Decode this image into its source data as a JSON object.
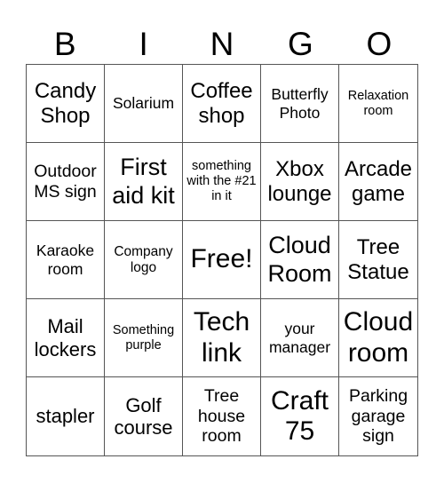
{
  "header": {
    "letters": [
      "B",
      "I",
      "N",
      "G",
      "O"
    ]
  },
  "cells": [
    "Candy Shop",
    "Solarium",
    "Coffee shop",
    "Butterfly Photo",
    "Relaxation room",
    "Outdoor MS sign",
    "First aid kit",
    "something with the #21 in it",
    "Xbox lounge",
    "Arcade game",
    "Karaoke room",
    "Company logo",
    "Free!",
    "Cloud Room",
    "Tree Statue",
    "Mail lockers",
    "Something purple",
    "Tech link",
    "your manager",
    "Cloud room",
    "stapler",
    "Golf course",
    "Tree house room",
    "Craft 75",
    "Parking garage sign"
  ]
}
